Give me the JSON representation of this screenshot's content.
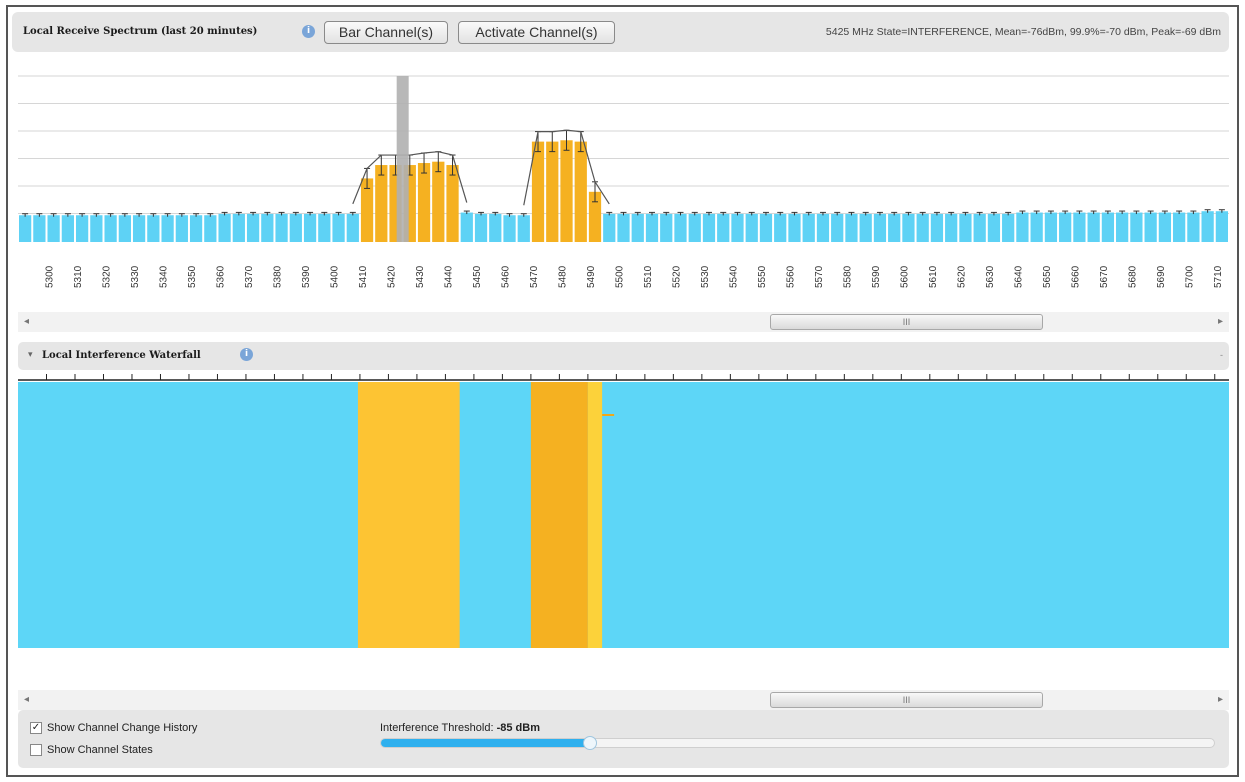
{
  "spectrum": {
    "title": "Local Receive Spectrum (last 20 minutes)",
    "bar_button": "Bar Channel(s)",
    "activate_button": "Activate Channel(s)",
    "status": "5425 MHz State=INTERFERENCE, Mean=-76dBm, 99.9%=-70 dBm, Peak=-69 dBm"
  },
  "waterfall": {
    "title": "Local Interference Waterfall"
  },
  "scrollbar": {
    "thumb_glyph": "III",
    "left_arrow": "◂",
    "right_arrow": "▸"
  },
  "controls": {
    "show_history_label": "Show Channel Change History",
    "show_history_checked": true,
    "show_states_label": "Show Channel States",
    "show_states_checked": false,
    "threshold_label": "Interference Threshold:",
    "threshold_value": "-85 dBm",
    "threshold_fraction": 0.25
  },
  "colors": {
    "normal": "#5ed2f5",
    "interference": "#f5b121",
    "interference_light": "#fdc433",
    "waterfall_bg": "#5dd6f7",
    "active_channel": "#b0b0b0"
  },
  "chart_data": {
    "type": "bar",
    "x_tick_labels": [
      "5300",
      "5310",
      "5320",
      "5330",
      "5340",
      "5350",
      "5360",
      "5370",
      "5380",
      "5390",
      "5400",
      "5410",
      "5420",
      "5430",
      "5440",
      "5450",
      "5460",
      "5470",
      "5480",
      "5490",
      "5500",
      "5510",
      "5520",
      "5530",
      "5540",
      "5550",
      "5560",
      "5570",
      "5580",
      "5590",
      "5600",
      "5610",
      "5620",
      "5630",
      "5640",
      "5650",
      "5660",
      "5670",
      "5680",
      "5690",
      "5700",
      "5710"
    ],
    "x_start": 5290,
    "x_end": 5715,
    "bar_step": 5,
    "ylim": [
      -90,
      -64
    ],
    "baseline_dbm": -86,
    "bars": [
      {
        "x": 5290,
        "v": -86.0
      },
      {
        "x": 5295,
        "v": -86.0
      },
      {
        "x": 5300,
        "v": -86.0
      },
      {
        "x": 5305,
        "v": -86.0
      },
      {
        "x": 5310,
        "v": -86.0
      },
      {
        "x": 5315,
        "v": -86.0
      },
      {
        "x": 5320,
        "v": -86.0
      },
      {
        "x": 5325,
        "v": -86.0
      },
      {
        "x": 5330,
        "v": -86.0
      },
      {
        "x": 5335,
        "v": -86.0
      },
      {
        "x": 5340,
        "v": -86.0
      },
      {
        "x": 5345,
        "v": -86.0
      },
      {
        "x": 5350,
        "v": -86.0
      },
      {
        "x": 5355,
        "v": -86.0
      },
      {
        "x": 5360,
        "v": -85.8
      },
      {
        "x": 5365,
        "v": -85.8
      },
      {
        "x": 5370,
        "v": -85.8
      },
      {
        "x": 5375,
        "v": -85.8
      },
      {
        "x": 5380,
        "v": -85.8
      },
      {
        "x": 5385,
        "v": -85.8
      },
      {
        "x": 5390,
        "v": -85.8
      },
      {
        "x": 5395,
        "v": -85.8
      },
      {
        "x": 5400,
        "v": -85.8
      },
      {
        "x": 5405,
        "v": -85.8
      },
      {
        "x": 5410,
        "v": -80.5
      },
      {
        "x": 5415,
        "v": -78.5
      },
      {
        "x": 5420,
        "v": -78.5
      },
      {
        "x": 5425,
        "v": -78.5
      },
      {
        "x": 5430,
        "v": -78.2
      },
      {
        "x": 5435,
        "v": -78.0
      },
      {
        "x": 5440,
        "v": -78.5
      },
      {
        "x": 5445,
        "v": -85.6
      },
      {
        "x": 5450,
        "v": -85.8
      },
      {
        "x": 5455,
        "v": -85.8
      },
      {
        "x": 5460,
        "v": -86.0
      },
      {
        "x": 5465,
        "v": -86.0
      },
      {
        "x": 5470,
        "v": -75.0
      },
      {
        "x": 5475,
        "v": -75.0
      },
      {
        "x": 5480,
        "v": -74.8
      },
      {
        "x": 5485,
        "v": -75.0
      },
      {
        "x": 5490,
        "v": -82.5
      },
      {
        "x": 5495,
        "v": -85.8
      },
      {
        "x": 5500,
        "v": -85.8
      },
      {
        "x": 5505,
        "v": -85.8
      },
      {
        "x": 5510,
        "v": -85.8
      },
      {
        "x": 5515,
        "v": -85.8
      },
      {
        "x": 5520,
        "v": -85.8
      },
      {
        "x": 5525,
        "v": -85.8
      },
      {
        "x": 5530,
        "v": -85.8
      },
      {
        "x": 5535,
        "v": -85.8
      },
      {
        "x": 5540,
        "v": -85.8
      },
      {
        "x": 5545,
        "v": -85.8
      },
      {
        "x": 5550,
        "v": -85.8
      },
      {
        "x": 5555,
        "v": -85.8
      },
      {
        "x": 5560,
        "v": -85.8
      },
      {
        "x": 5565,
        "v": -85.8
      },
      {
        "x": 5570,
        "v": -85.8
      },
      {
        "x": 5575,
        "v": -85.8
      },
      {
        "x": 5580,
        "v": -85.8
      },
      {
        "x": 5585,
        "v": -85.8
      },
      {
        "x": 5590,
        "v": -85.8
      },
      {
        "x": 5595,
        "v": -85.8
      },
      {
        "x": 5600,
        "v": -85.8
      },
      {
        "x": 5605,
        "v": -85.8
      },
      {
        "x": 5610,
        "v": -85.8
      },
      {
        "x": 5615,
        "v": -85.8
      },
      {
        "x": 5620,
        "v": -85.8
      },
      {
        "x": 5625,
        "v": -85.8
      },
      {
        "x": 5630,
        "v": -85.8
      },
      {
        "x": 5635,
        "v": -85.8
      },
      {
        "x": 5640,
        "v": -85.6
      },
      {
        "x": 5645,
        "v": -85.6
      },
      {
        "x": 5650,
        "v": -85.6
      },
      {
        "x": 5655,
        "v": -85.6
      },
      {
        "x": 5660,
        "v": -85.6
      },
      {
        "x": 5665,
        "v": -85.6
      },
      {
        "x": 5670,
        "v": -85.6
      },
      {
        "x": 5675,
        "v": -85.6
      },
      {
        "x": 5680,
        "v": -85.6
      },
      {
        "x": 5685,
        "v": -85.6
      },
      {
        "x": 5690,
        "v": -85.6
      },
      {
        "x": 5695,
        "v": -85.6
      },
      {
        "x": 5700,
        "v": -85.6
      },
      {
        "x": 5705,
        "v": -85.4
      },
      {
        "x": 5710,
        "v": -85.4
      }
    ],
    "interference_bands": [
      [
        5410,
        5445
      ],
      [
        5470,
        5495
      ]
    ],
    "active_channel_mhz": 5425,
    "grid": true
  }
}
